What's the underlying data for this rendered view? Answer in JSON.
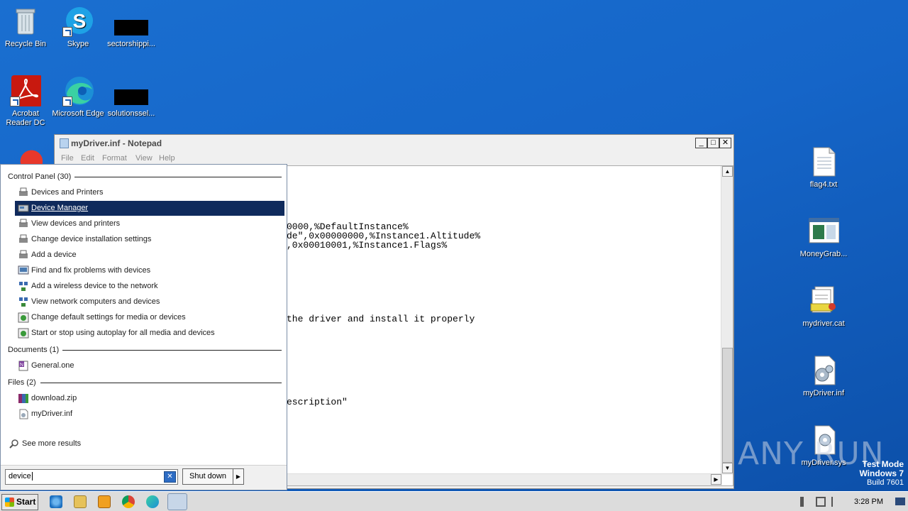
{
  "desktop": {
    "icons_left": [
      {
        "label": "Recycle Bin"
      },
      {
        "label": "Skype"
      },
      {
        "label": "sectorshippi..."
      },
      {
        "label": "Acrobat Reader DC"
      },
      {
        "label": "Microsoft Edge"
      },
      {
        "label": "solutionssel..."
      }
    ],
    "icons_right": [
      {
        "label": "flag4.txt"
      },
      {
        "label": "MoneyGrab..."
      },
      {
        "label": "mydriver.cat"
      },
      {
        "label": "myDriver.inf"
      },
      {
        "label": "myDriver.sys"
      }
    ]
  },
  "notepad": {
    "title": "myDriver.inf - Notepad",
    "menu": [
      "File",
      "Edit",
      "Format",
      "View",
      "Help"
    ],
    "lines": [
      "0000,%DefaultInstance%",
      "de\",0x00000000,%Instance1.Altitude%",
      ",0x00010001,%Instance1.Flags%",
      "the driver and install it properly",
      "escription\""
    ]
  },
  "start_menu": {
    "sections": [
      {
        "title": "Control Panel (30)",
        "items": [
          "Devices and Printers",
          "Device Manager",
          "View devices and printers",
          "Change device installation settings",
          "Add a device",
          "Find and fix problems with devices",
          "Add a wireless device to the network",
          "View network computers and devices",
          "Change default settings for media or devices",
          "Start or stop using autoplay for all media and devices"
        ]
      },
      {
        "title": "Documents (1)",
        "items": [
          "General.one"
        ]
      },
      {
        "title": "Files (2)",
        "items": [
          "download.zip",
          "myDriver.inf"
        ]
      }
    ],
    "selected_item": "Device Manager",
    "see_more": "See more results",
    "search_value": "device",
    "shutdown_label": "Shut down"
  },
  "taskbar": {
    "start_label": "Start",
    "clock": "3:28 PM"
  },
  "watermark": {
    "line1": "Test Mode",
    "line2": "Windows 7",
    "line3": "Build 7601",
    "brand": "ANY RUN"
  },
  "colors": {
    "selection": "#0f2a5c",
    "desktop": "#1565c8"
  }
}
